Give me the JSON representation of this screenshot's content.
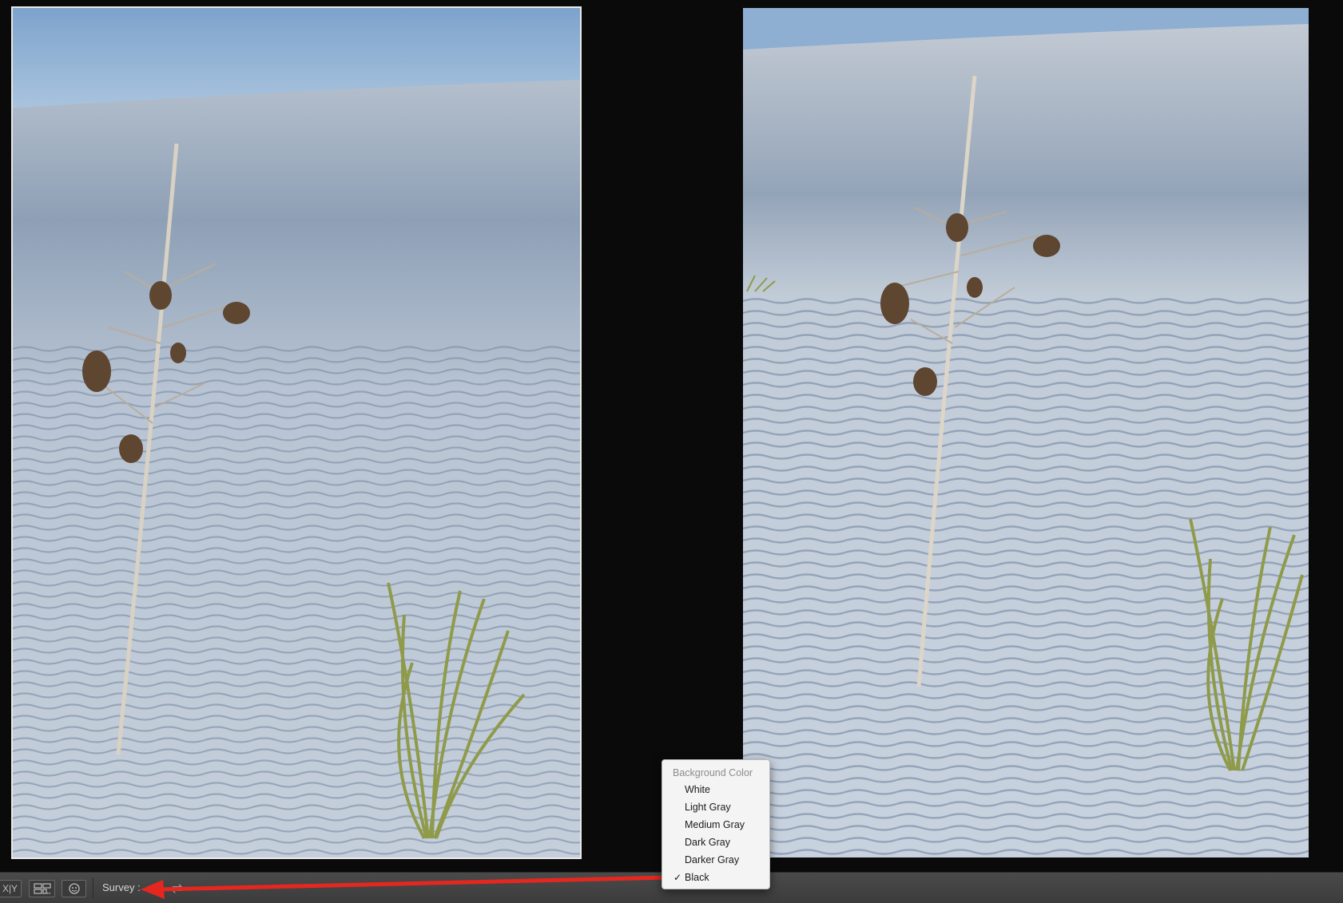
{
  "toolbar": {
    "xy_label": "X|Y",
    "survey_label": "Survey :"
  },
  "menu": {
    "header": "Background Color",
    "items": [
      {
        "label": "White",
        "checked": false
      },
      {
        "label": "Light Gray",
        "checked": false
      },
      {
        "label": "Medium Gray",
        "checked": false
      },
      {
        "label": "Dark Gray",
        "checked": false
      },
      {
        "label": "Darker Gray",
        "checked": false
      },
      {
        "label": "Black",
        "checked": true
      }
    ],
    "check_glyph": "✓"
  },
  "colors": {
    "arrow": "#e6271f",
    "workspace": "#0a0a0a",
    "sand": "#c9d3df",
    "sky": "#8fb1d6"
  }
}
